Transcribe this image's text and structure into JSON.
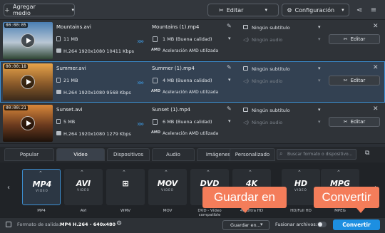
{
  "toolbar": {
    "add_media": "Agregar medio",
    "edit": "Editar",
    "settings": "Configuración"
  },
  "files": [
    {
      "duration": "00:00:05",
      "name": "Mountains.avi",
      "size": "11 MB",
      "info": "H.264 1920x1080 10411 Kbps",
      "out_name": "Mountains (1).mp4",
      "out_size": "1 MB (Buena calidad)",
      "hw": "Aceleración AMD utilizada",
      "subtitle": "Ningún subtítulo",
      "audio": "Ningún audio",
      "edit": "Editar",
      "thumb_colors": [
        "#4a7fb4",
        "#b9c7d4",
        "#2f4634"
      ]
    },
    {
      "duration": "00:00:18",
      "name": "Summer.avi",
      "size": "21 MB",
      "info": "H.264 1920x1080 9568 Kbps",
      "out_name": "Summer (1).mp4",
      "out_size": "4 MB (Buena calidad)",
      "hw": "Aceleración AMD utilizada",
      "subtitle": "Ningún subtítulo",
      "audio": "Ningún audio",
      "edit": "Editar",
      "thumb_colors": [
        "#e9a44a",
        "#8a5a2a",
        "#3b2a1a"
      ]
    },
    {
      "duration": "00:00:21",
      "name": "Sunset.avi",
      "size": "5 MB",
      "info": "H.264 1920x1080 1279 Kbps",
      "out_name": "Sunset (1).mp4",
      "out_size": "6 MB (Buena calidad)",
      "hw": "Aceleración AMD utilizada",
      "subtitle": "Ningún subtítulo",
      "audio": "Ningún audio",
      "edit": "Editar",
      "thumb_colors": [
        "#d9883a",
        "#6b3a1e",
        "#1d120b"
      ]
    }
  ],
  "tabs": [
    "Popular",
    "Video",
    "Dispositivos",
    "Audio",
    "Imágenes",
    "Personalizado"
  ],
  "active_tab": "Video",
  "search_placeholder": "Buscar formato o dispositivo...",
  "formats": [
    {
      "logo": "MP4",
      "sub": "VIDEO",
      "label": "MP4",
      "selected": true
    },
    {
      "logo": "AVI",
      "sub": "VIDEO",
      "label": "AVI",
      "selected": false
    },
    {
      "logo": "⊞",
      "sub": "",
      "label": "WMV",
      "selected": false
    },
    {
      "logo": "MOV",
      "sub": "VIDEO",
      "label": "MOV",
      "selected": false
    },
    {
      "logo": "DVD",
      "sub": "",
      "label": "DVD - Vídeo compatible",
      "selected": false
    },
    {
      "logo": "4K",
      "sub": "",
      "label": "4K Ultra HD",
      "selected": false
    },
    {
      "logo": "HD",
      "sub": "VIDEO",
      "label": "HD/Full HD",
      "selected": false
    },
    {
      "logo": "MPG",
      "sub": "",
      "label": "MPEG",
      "selected": false
    }
  ],
  "footer": {
    "output_label": "Formato de salida:",
    "output_value": "MP4 H.264 - 640x480",
    "save_to": "Guardar en...",
    "join_label": "Fusionar archivos:",
    "convert": "Convertir"
  },
  "callouts": {
    "save": "Guardar en",
    "convert": "Convertir"
  },
  "colors": {
    "accent": "#1d8fe1",
    "callout": "#f47d5a"
  }
}
